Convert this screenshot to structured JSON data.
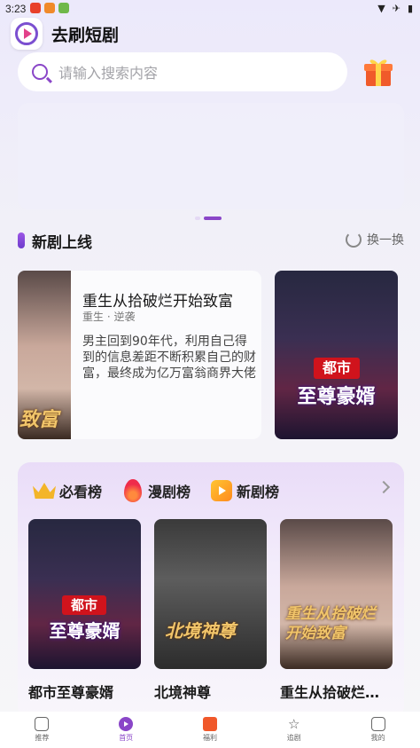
{
  "status_bar": {
    "time": "3:23"
  },
  "header": {
    "app_name": "去刷短剧"
  },
  "search": {
    "placeholder": "请输入搜索内容"
  },
  "banner": {
    "active_index": 1,
    "count": 2
  },
  "new_section": {
    "title": "新剧上线",
    "refresh_label": "换一换",
    "featured": {
      "title": "重生从拾破烂开始致富",
      "tags": "重生 · 逆袭",
      "description": "男主回到90年代，利用自己得到的信息差距不断积累自己的财富，最终成为亿万富翁商界大佬",
      "poster_text": "致富"
    },
    "side_poster": {
      "tag": "都市",
      "title": "至尊豪婿"
    }
  },
  "rankings": {
    "tabs": [
      {
        "label": "必看榜",
        "icon": "crown-icon"
      },
      {
        "label": "漫剧榜",
        "icon": "flame-icon"
      },
      {
        "label": "新剧榜",
        "icon": "play-badge-icon"
      }
    ],
    "items": [
      {
        "name": "都市至尊豪婿",
        "poster_tag": "都市",
        "poster_title": "至尊豪婿"
      },
      {
        "name": "北境神尊",
        "poster_title": "北境神尊"
      },
      {
        "name": "重生从拾破烂开始致富",
        "poster_title": "重生从拾破烂开始致富"
      }
    ]
  },
  "tab_bar": {
    "tabs": [
      {
        "label": "推荐",
        "icon": "recommend-icon"
      },
      {
        "label": "首页",
        "icon": "play-circle-icon",
        "active": true
      },
      {
        "label": "福利",
        "icon": "gift-icon"
      },
      {
        "label": "追剧",
        "icon": "star-icon"
      },
      {
        "label": "我的",
        "icon": "profile-icon"
      }
    ]
  },
  "colors": {
    "accent": "#8a46c8",
    "background": "#f4f3f8"
  }
}
